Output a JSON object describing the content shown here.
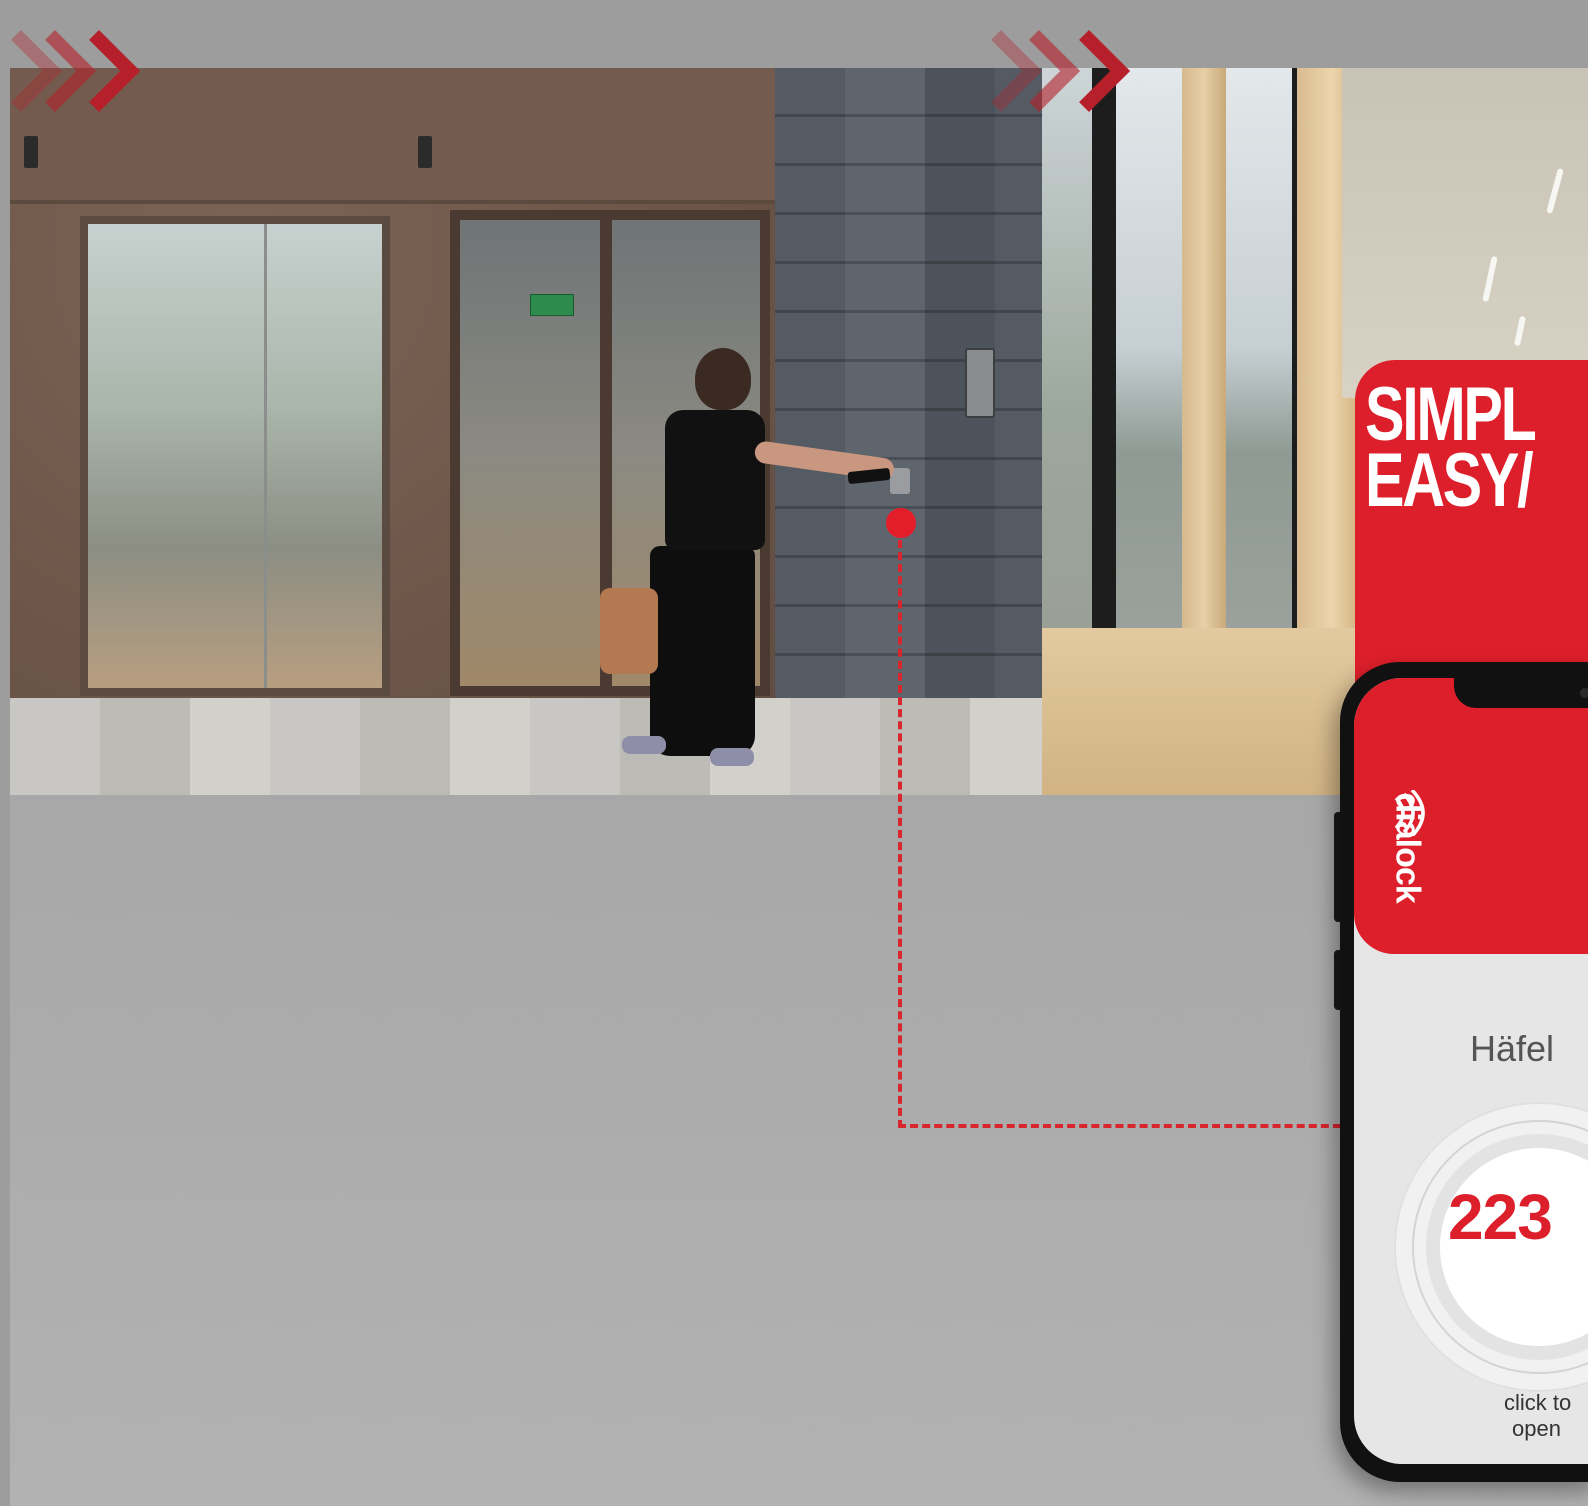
{
  "promo": {
    "headline_line1": "SIMPL",
    "headline_line2": "EASY/"
  },
  "app": {
    "logo_text": "dialock",
    "brand_label": "Häfel",
    "room_number": "223",
    "hint_line1": "click to",
    "hint_line2": "open"
  },
  "colors": {
    "brand_red": "#dd1f2b",
    "chevron_red": "#b5202a",
    "background_gray": "#a8a8a8"
  },
  "icons": [
    "chevron-right-icon",
    "nfc-signal-icon"
  ]
}
